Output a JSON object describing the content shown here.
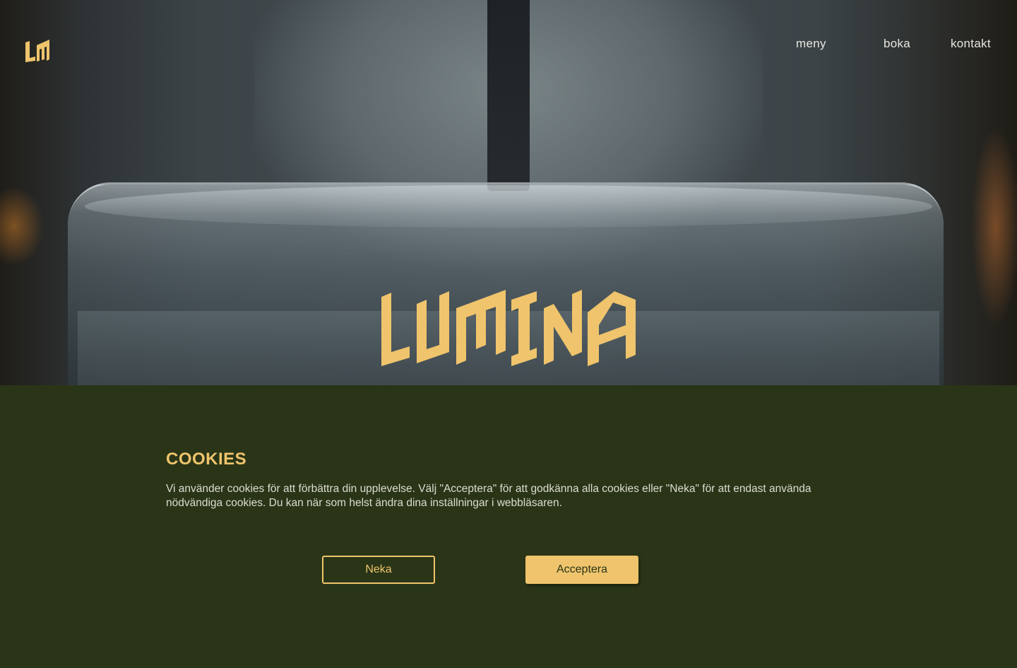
{
  "header": {
    "logo_icon": "lm-monogram-logo",
    "nav": [
      {
        "label": "meny"
      },
      {
        "label": "boka"
      },
      {
        "label": "kontakt"
      }
    ]
  },
  "hero": {
    "brand_name": "LUMINA",
    "brand_icon": "lumina-wordmark-logo"
  },
  "cookie_banner": {
    "title": "COOKIES",
    "text": "Vi använder cookies för att förbättra din upplevelse. Välj \"Acceptera\" för att godkänna alla cookies eller \"Neka\" för att endast använda nödvändiga cookies. Du kan när som helst ändra dina inställningar i webbläsaren.",
    "decline_label": "Neka",
    "accept_label": "Acceptera"
  },
  "colors": {
    "accent": "#efc46c",
    "banner_bg": "#2a3517",
    "nav_text": "#e8e6e0"
  }
}
